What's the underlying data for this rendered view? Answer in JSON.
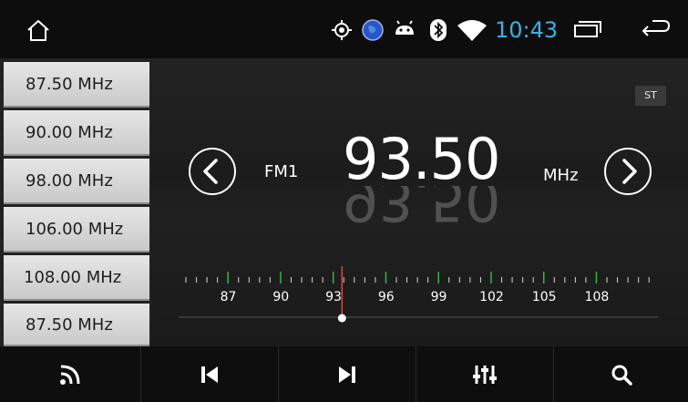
{
  "status_bar": {
    "clock": "10:43",
    "icons": [
      "home-icon",
      "gps-icon",
      "globe-icon",
      "android-icon",
      "bluetooth-icon",
      "wifi-icon",
      "recent-apps-icon",
      "back-icon"
    ],
    "clock_color": "#33b5e5"
  },
  "presets": [
    {
      "label": "87.50 MHz"
    },
    {
      "label": "90.00 MHz"
    },
    {
      "label": "98.00 MHz"
    },
    {
      "label": "106.00 MHz"
    },
    {
      "label": "108.00 MHz"
    },
    {
      "label": "87.50 MHz"
    }
  ],
  "tuner": {
    "stereo_badge": "ST",
    "band": "FM1",
    "frequency": "93.50",
    "unit": "MHz",
    "scale_labels": [
      "87",
      "90",
      "93",
      "96",
      "99",
      "102",
      "105",
      "108"
    ],
    "needle_value": 93.5,
    "needle_color": "#e0473a",
    "tick_accent_color": "#3cb043"
  },
  "toolbar": {
    "buttons": [
      "rss-icon",
      "previous-icon",
      "next-icon",
      "equalizer-icon",
      "search-icon"
    ]
  }
}
